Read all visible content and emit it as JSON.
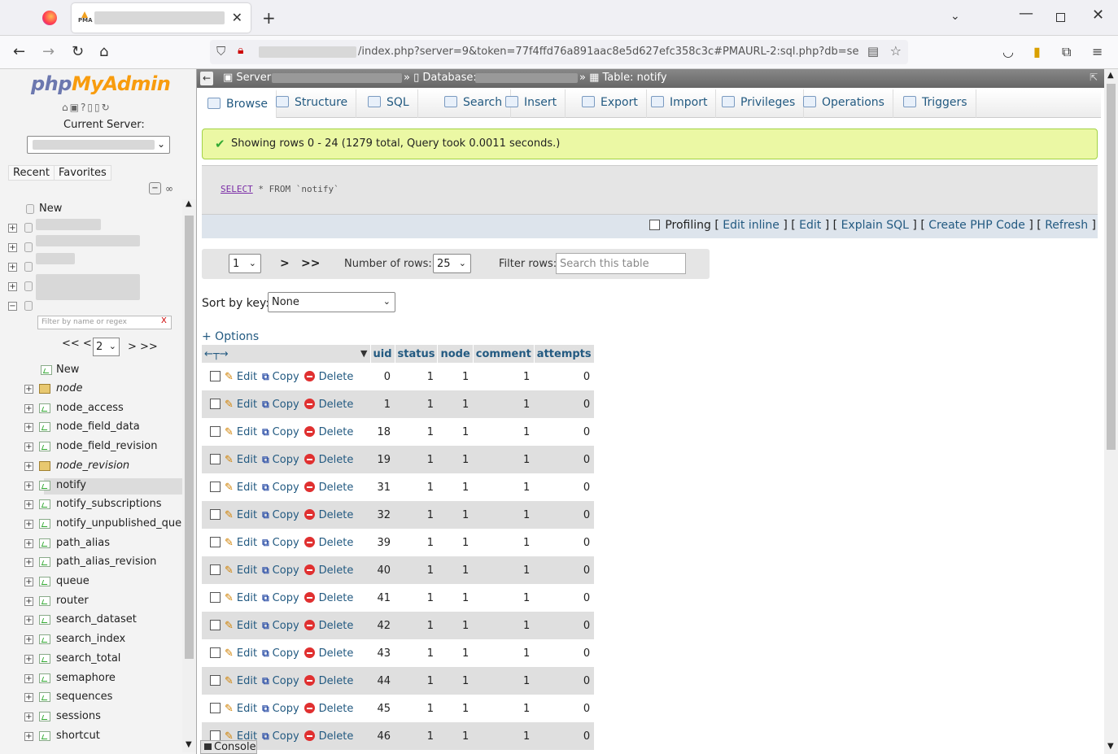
{
  "browser": {
    "tab_pma_label": "PMA",
    "new_tab_symbol": "+",
    "url_path": "/index.php?server=9&token=77f4ffd76a891aac8e5d627efc358c3c#PMAURL-2:sql.php?db=sepamco"
  },
  "left": {
    "logo_php": "php",
    "logo_myadmin": "MyAdmin",
    "current_server_label": "Current Server:",
    "recent_label": "Recent",
    "favorites_label": "Favorites",
    "new_label": "New",
    "filter_placeholder": "Filter by name or regex",
    "filter_clear": "X",
    "pager_prev": "<< <",
    "pager_value": "2",
    "pager_next": "> >>",
    "tables": [
      {
        "name": "node",
        "view": true
      },
      {
        "name": "node_access",
        "view": false
      },
      {
        "name": "node_field_data",
        "view": false
      },
      {
        "name": "node_field_revision",
        "view": false
      },
      {
        "name": "node_revision",
        "view": true
      },
      {
        "name": "notify",
        "view": false,
        "selected": true
      },
      {
        "name": "notify_subscriptions",
        "view": false
      },
      {
        "name": "notify_unpublished_queue",
        "view": false
      },
      {
        "name": "path_alias",
        "view": false
      },
      {
        "name": "path_alias_revision",
        "view": false
      },
      {
        "name": "queue",
        "view": false
      },
      {
        "name": "router",
        "view": false
      },
      {
        "name": "search_dataset",
        "view": false
      },
      {
        "name": "search_index",
        "view": false
      },
      {
        "name": "search_total",
        "view": false
      },
      {
        "name": "semaphore",
        "view": false
      },
      {
        "name": "sequences",
        "view": false
      },
      {
        "name": "sessions",
        "view": false
      },
      {
        "name": "shortcut",
        "view": false
      }
    ]
  },
  "breadcrumb": {
    "server_label": "Server:",
    "database_label": "Database:",
    "table_label": "Table: notify"
  },
  "menu": {
    "tabs": [
      {
        "label": "Browse"
      },
      {
        "label": "Structure"
      },
      {
        "label": "SQL"
      },
      {
        "label": "Search"
      },
      {
        "label": "Insert"
      },
      {
        "label": "Export"
      },
      {
        "label": "Import"
      },
      {
        "label": "Privileges"
      },
      {
        "label": "Operations"
      },
      {
        "label": "Triggers"
      }
    ]
  },
  "result": {
    "message": "Showing rows 0 - 24 (1279 total, Query took 0.0011 seconds.)",
    "sql_keyword": "SELECT",
    "sql_rest": "* FROM `notify`",
    "profiling_label": "Profiling",
    "edit_inline": "Edit inline",
    "edit": "Edit",
    "explain_sql": "Explain SQL",
    "create_php_code": "Create PHP Code",
    "refresh": "Refresh"
  },
  "nav": {
    "page_value": "1",
    "next": ">",
    "last": ">>",
    "rows_label": "Number of rows:",
    "rows_value": "25",
    "filter_label": "Filter rows:",
    "filter_placeholder": "Search this table",
    "sort_label": "Sort by key:",
    "sort_value": "None",
    "options_label": "+ Options"
  },
  "table": {
    "columns": [
      "uid",
      "status",
      "node",
      "comment",
      "attempts"
    ],
    "action_edit": "Edit",
    "action_copy": "Copy",
    "action_delete": "Delete",
    "rows": [
      [
        "0",
        "1",
        "1",
        "1",
        "0"
      ],
      [
        "1",
        "1",
        "1",
        "1",
        "0"
      ],
      [
        "18",
        "1",
        "1",
        "1",
        "0"
      ],
      [
        "19",
        "1",
        "1",
        "1",
        "0"
      ],
      [
        "31",
        "1",
        "1",
        "1",
        "0"
      ],
      [
        "32",
        "1",
        "1",
        "1",
        "0"
      ],
      [
        "39",
        "1",
        "1",
        "1",
        "0"
      ],
      [
        "40",
        "1",
        "1",
        "1",
        "0"
      ],
      [
        "41",
        "1",
        "1",
        "1",
        "0"
      ],
      [
        "42",
        "1",
        "1",
        "1",
        "0"
      ],
      [
        "43",
        "1",
        "1",
        "1",
        "0"
      ],
      [
        "44",
        "1",
        "1",
        "1",
        "0"
      ],
      [
        "45",
        "1",
        "1",
        "1",
        "0"
      ],
      [
        "46",
        "1",
        "1",
        "1",
        "0"
      ]
    ]
  },
  "console_label": "Console"
}
